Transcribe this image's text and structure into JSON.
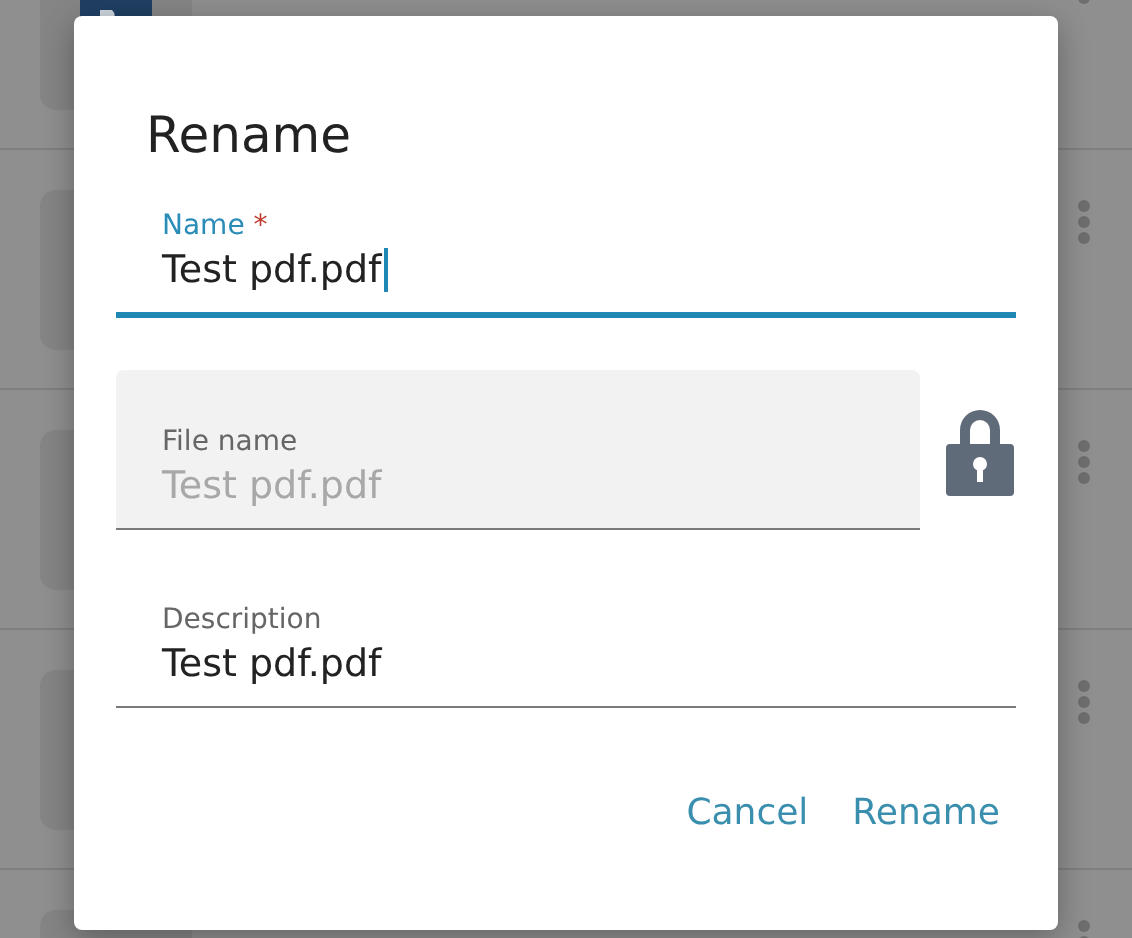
{
  "background_list": {
    "rows": [
      {
        "kind": "document"
      },
      {
        "kind": "file"
      },
      {
        "kind": "file"
      },
      {
        "kind": "file"
      },
      {
        "kind": "file"
      }
    ]
  },
  "dialog": {
    "title": "Rename",
    "fields": [
      {
        "label": "Name",
        "required_mark": "*",
        "value": "Test pdf.pdf",
        "focused": true,
        "disabled": false,
        "locked": false
      },
      {
        "label": "File name",
        "value": "Test pdf.pdf",
        "focused": false,
        "disabled": true,
        "locked": true
      },
      {
        "label": "Description",
        "value": "Test pdf.pdf",
        "focused": false,
        "disabled": false,
        "locked": false
      }
    ],
    "buttons": [
      "Cancel",
      "Rename"
    ]
  }
}
